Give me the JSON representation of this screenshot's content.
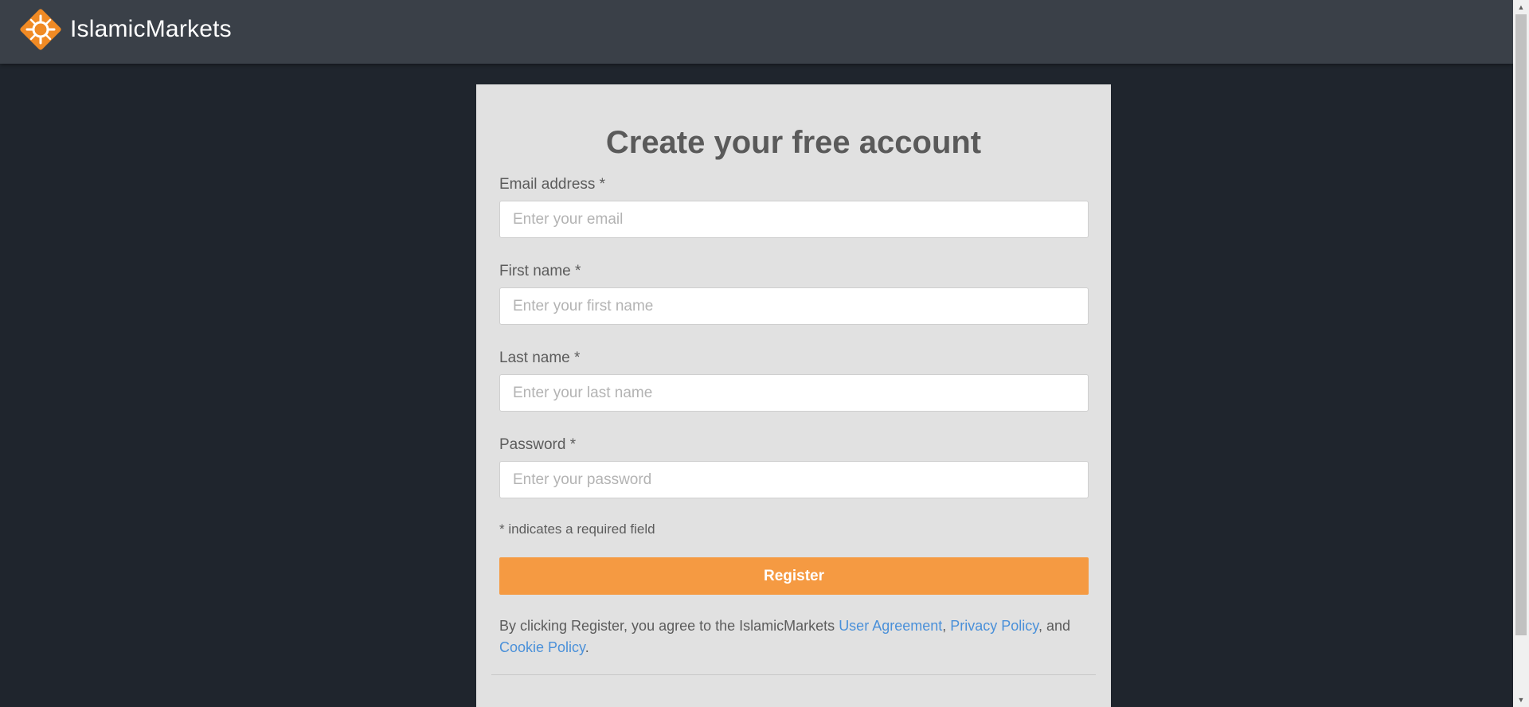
{
  "header": {
    "brand_name": "IslamicMarkets",
    "logo_icon": "islamicmarkets-logo-icon",
    "bar_color": "#3a4048"
  },
  "form": {
    "title": "Create your free account",
    "fields": [
      {
        "label": "Email address *",
        "placeholder": "Enter your email",
        "value": ""
      },
      {
        "label": "First name *",
        "placeholder": "Enter your first name",
        "value": ""
      },
      {
        "label": "Last name *",
        "placeholder": "Enter your last name",
        "value": ""
      },
      {
        "label": "Password *",
        "placeholder": "Enter your password",
        "value": ""
      }
    ],
    "required_note": "* indicates a required field",
    "register_label": "Register",
    "register_color": "#f59a42"
  },
  "legal": {
    "prefix": "By clicking Register, you agree to the IslamicMarkets ",
    "user_agreement": "User Agreement",
    "sep1": ", ",
    "privacy_policy": "Privacy Policy",
    "sep2": ", and ",
    "cookie_policy": "Cookie Policy",
    "suffix": ".",
    "link_color": "#4a90d9"
  },
  "colors": {
    "page_background": "#1f252d",
    "card_background": "#e1e1e1"
  }
}
